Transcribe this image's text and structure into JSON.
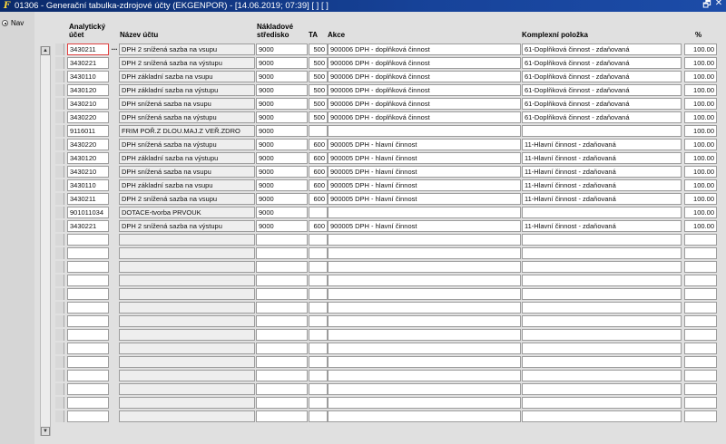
{
  "window": {
    "title": "01306 - Generační tabulka-zdrojové účty (EKGENPOR) - [14.06.2019; 07:39]  [ ]  [ ]",
    "icon": "app-logo-icon",
    "controls": {
      "restore": "🗗",
      "close": "✕"
    }
  },
  "nav": {
    "label": "Nav",
    "selected": true
  },
  "headers": {
    "ucet_line1": "Analytický",
    "ucet_line2": "účet",
    "nazev": "Název účtu",
    "stredisko_line1": "Nákladové",
    "stredisko_line2": "středisko",
    "ta": "TA",
    "akce": "Akce",
    "polozka": "Komplexní položka",
    "pct": "%"
  },
  "rows": [
    {
      "ucet": "3430211",
      "nazev": "DPH 2 snížená sazba na vsupu",
      "stredisko": "9000",
      "ta": "500",
      "akce": "900006 DPH - doplňková činnost",
      "polozka": "61-Doplňková činnost - zdaňovaná",
      "pct": "100.00"
    },
    {
      "ucet": "3430221",
      "nazev": "DPH 2 snížená sazba na výstupu",
      "stredisko": "9000",
      "ta": "500",
      "akce": "900006 DPH - doplňková činnost",
      "polozka": "61-Doplňková činnost - zdaňovaná",
      "pct": "100.00"
    },
    {
      "ucet": "3430110",
      "nazev": "DPH základní sazba na vsupu",
      "stredisko": "9000",
      "ta": "500",
      "akce": "900006 DPH - doplňková činnost",
      "polozka": "61-Doplňková činnost - zdaňovaná",
      "pct": "100.00"
    },
    {
      "ucet": "3430120",
      "nazev": "DPH základní sazba na výstupu",
      "stredisko": "9000",
      "ta": "500",
      "akce": "900006 DPH - doplňková činnost",
      "polozka": "61-Doplňková činnost - zdaňovaná",
      "pct": "100.00"
    },
    {
      "ucet": "3430210",
      "nazev": "DPH snížená sazba na vsupu",
      "stredisko": "9000",
      "ta": "500",
      "akce": "900006 DPH - doplňková činnost",
      "polozka": "61-Doplňková činnost - zdaňovaná",
      "pct": "100.00"
    },
    {
      "ucet": "3430220",
      "nazev": "DPH snížená sazba na výstupu",
      "stredisko": "9000",
      "ta": "500",
      "akce": "900006 DPH - doplňková činnost",
      "polozka": "61-Doplňková činnost - zdaňovaná",
      "pct": "100.00"
    },
    {
      "ucet": "9116011",
      "nazev": "FRIM POŘ.Z DLOU.MAJ.Z VEŘ.ZDRO",
      "stredisko": "9000",
      "ta": "",
      "akce": "",
      "polozka": "",
      "pct": "100.00"
    },
    {
      "ucet": "3430220",
      "nazev": "DPH snížená sazba na výstupu",
      "stredisko": "9000",
      "ta": "600",
      "akce": "900005 DPH - hlavní činnost",
      "polozka": "11-Hlavní činnost - zdaňovaná",
      "pct": "100.00"
    },
    {
      "ucet": "3430120",
      "nazev": "DPH základní sazba na výstupu",
      "stredisko": "9000",
      "ta": "600",
      "akce": "900005 DPH - hlavní činnost",
      "polozka": "11-Hlavní činnost - zdaňovaná",
      "pct": "100.00"
    },
    {
      "ucet": "3430210",
      "nazev": "DPH snížená sazba na vsupu",
      "stredisko": "9000",
      "ta": "600",
      "akce": "900005 DPH - hlavní činnost",
      "polozka": "11-Hlavní činnost - zdaňovaná",
      "pct": "100.00"
    },
    {
      "ucet": "3430110",
      "nazev": "DPH základní sazba na vsupu",
      "stredisko": "9000",
      "ta": "600",
      "akce": "900005 DPH - hlavní činnost",
      "polozka": "11-Hlavní činnost - zdaňovaná",
      "pct": "100.00"
    },
    {
      "ucet": "3430211",
      "nazev": "DPH 2 snížená sazba na vsupu",
      "stredisko": "9000",
      "ta": "600",
      "akce": "900005 DPH - hlavní činnost",
      "polozka": "11-Hlavní činnost - zdaňovaná",
      "pct": "100.00"
    },
    {
      "ucet": "901011034",
      "nazev": "DOTACE-tvorba PRVOUK",
      "stredisko": "9000",
      "ta": "",
      "akce": "",
      "polozka": "",
      "pct": "100.00"
    },
    {
      "ucet": "3430221",
      "nazev": "DPH 2 snížená sazba na výstupu",
      "stredisko": "9000",
      "ta": "600",
      "akce": "900005 DPH - hlavní činnost",
      "polozka": "11-Hlavní činnost - zdaňovaná",
      "pct": "100.00"
    }
  ],
  "empty_rows": 14,
  "ellipsis": "...",
  "scroll": {
    "up": "▲",
    "down": "▼"
  }
}
